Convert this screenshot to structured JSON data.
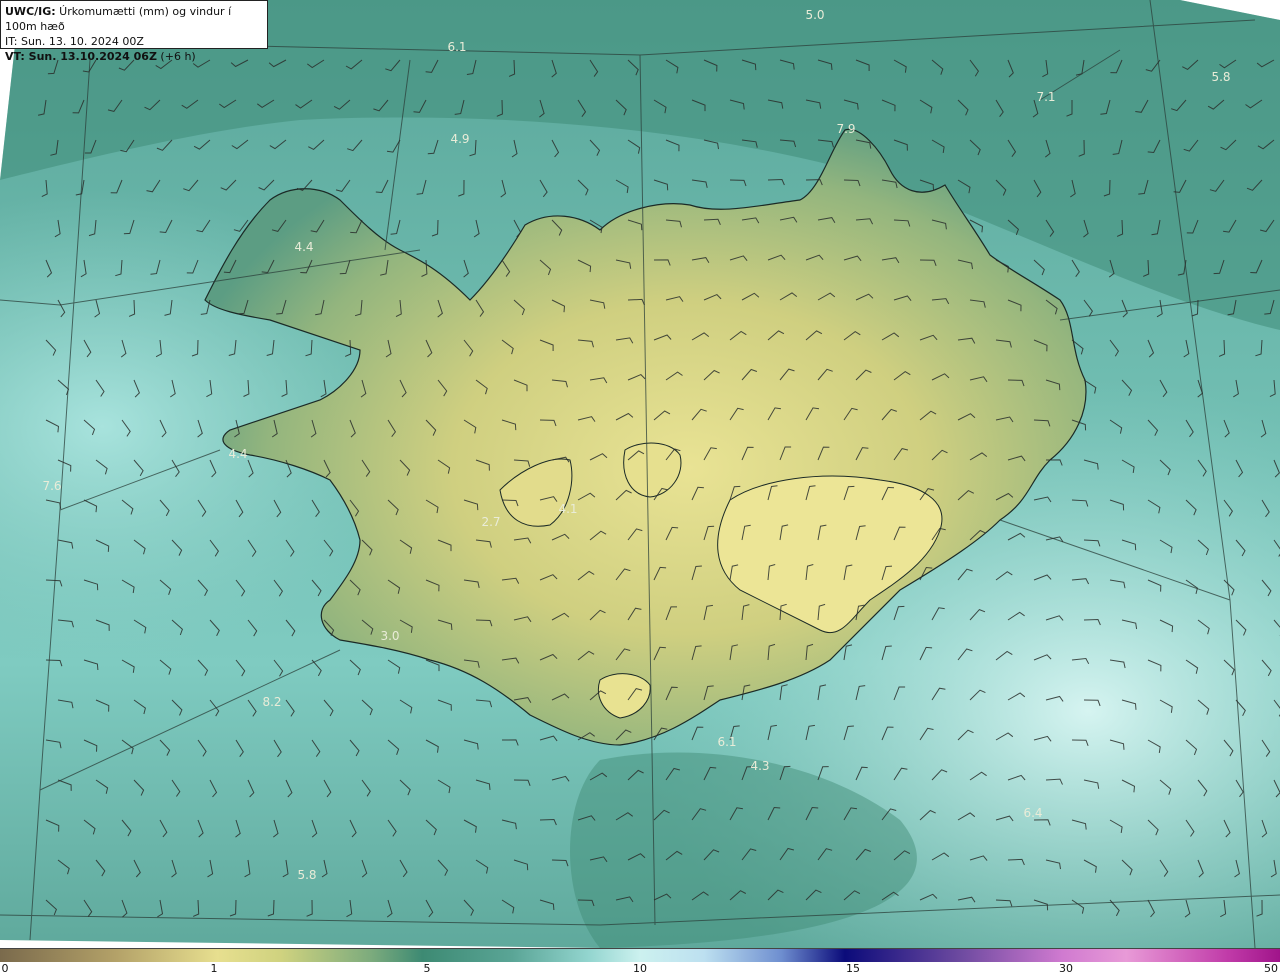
{
  "header": {
    "model": "UWC/IG:",
    "title": " Úrkomumætti (mm) og vindur í 100m hæð",
    "it_line": "IT: Sun. 13. 10. 2024 00Z",
    "vt_prefix": "VT: Sun. 13.10.2024 06Z",
    "vt_suffix": " (+6 h)"
  },
  "labels": [
    "5.0",
    "6.1",
    "5.8",
    "7.1",
    "4.9",
    "7.9",
    "4.4",
    "4.4",
    "7.6",
    "4.1",
    "2.7",
    "3.0",
    "8.2",
    "6.1",
    "4.3",
    "6.4",
    "5.8"
  ],
  "colorbar": {
    "ticks": [
      "0",
      "1",
      "5",
      "10",
      "15",
      "30",
      "50"
    ]
  },
  "colors": {
    "land_high": "#e6e08e",
    "land_mid": "#c9cc7e",
    "sea_dark": "#3f8c7a",
    "sea_light": "#bfeeea",
    "coast": "#1b2a26"
  }
}
